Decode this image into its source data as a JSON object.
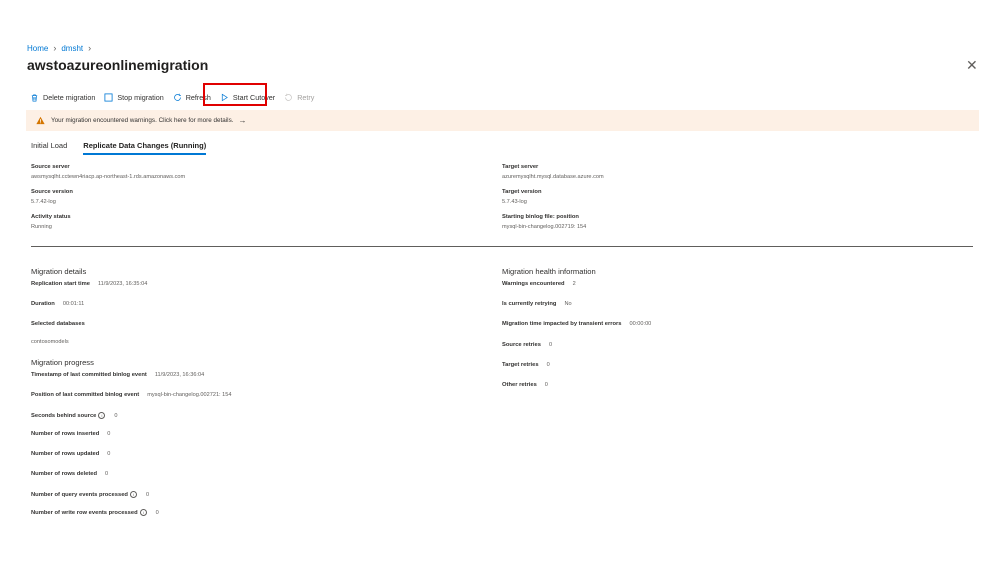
{
  "breadcrumb": {
    "home": "Home",
    "item": "dmsht"
  },
  "title": "awstoazureonlinemigration",
  "more_label": "···",
  "close_label": "✕",
  "toolbar": {
    "delete": "Delete migration",
    "stop": "Stop migration",
    "refresh": "Refresh",
    "cutover": "Start Cutover",
    "retry": "Retry"
  },
  "banner": {
    "text": "Your migration encountered warnings. Click here for more details.",
    "arrow": "→"
  },
  "tabs": {
    "initial": "Initial Load",
    "replicate": "Replicate Data Changes (Running)"
  },
  "source": {
    "server_label": "Source server",
    "server_value": "awsmysqlht.cctewn4riacp.ap-northeast-1.rds.amazonaws.com",
    "version_label": "Source version",
    "version_value": "5.7.42-log",
    "activity_label": "Activity status",
    "activity_value": "Running"
  },
  "target": {
    "server_label": "Target server",
    "server_value": "azuremysqlht.mysql.database.azure.com",
    "version_label": "Target version",
    "version_value": "5.7.43-log",
    "binlog_label": "Starting binlog file: position",
    "binlog_value": "mysql-bin-changelog.002719: 154"
  },
  "details": {
    "heading": "Migration details",
    "start_label": "Replication start time",
    "start_value": "11/9/2023, 16:35:04",
    "duration_label": "Duration",
    "duration_value": "00:01:11",
    "dbs_label": "Selected databases",
    "dbs_value": "contosomodels"
  },
  "progress": {
    "heading": "Migration progress",
    "ts_label": "Timestamp of last committed binlog event",
    "ts_value": "11/9/2023, 16:36:04",
    "pos_label": "Position of last committed binlog event",
    "pos_value": "mysql-bin-changelog.002721: 154",
    "behind_label": "Seconds behind source",
    "behind_value": "0",
    "inserted_label": "Number of rows inserted",
    "inserted_value": "0",
    "updated_label": "Number of rows updated",
    "updated_value": "0",
    "deleted_label": "Number of rows deleted",
    "deleted_value": "0",
    "query_label": "Number of query events processed",
    "query_value": "0",
    "write_label": "Number of write row events processed",
    "write_value": "0"
  },
  "health": {
    "heading": "Migration health information",
    "warnings_label": "Warnings encountered",
    "warnings_value": "2",
    "retrying_label": "Is currently retrying",
    "retrying_value": "No",
    "transient_label": "Migration time impacted by transient errors",
    "transient_value": "00:00:00",
    "src_retries_label": "Source retries",
    "src_retries_value": "0",
    "tgt_retries_label": "Target retries",
    "tgt_retries_value": "0",
    "other_retries_label": "Other retries",
    "other_retries_value": "0"
  },
  "info_glyph": "i",
  "colors": {
    "accent": "#0078d4",
    "warning_bg": "#fdf0e5",
    "highlight": "#e00000"
  }
}
